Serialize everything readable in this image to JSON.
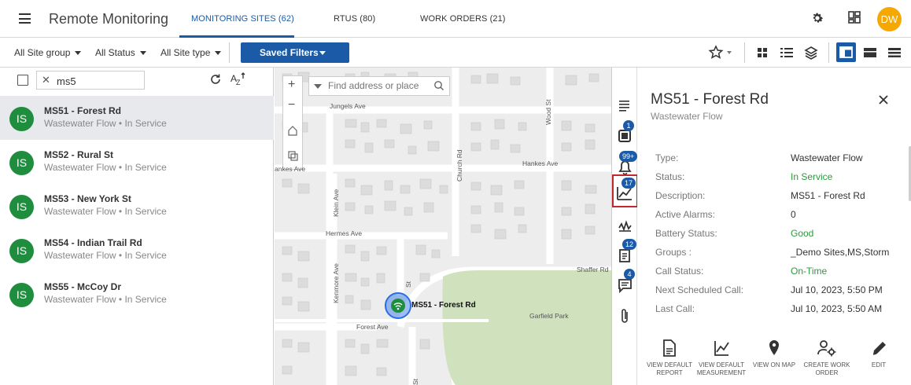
{
  "app": {
    "title": "Remote Monitoring",
    "user_initials": "DW"
  },
  "tabs": [
    {
      "label": "MONITORING SITES (62)",
      "active": true
    },
    {
      "label": "RTUS (80)",
      "active": false
    },
    {
      "label": "WORK ORDERS (21)",
      "active": false
    }
  ],
  "filters": {
    "site_group": "All Site group",
    "status": "All Status",
    "site_type": "All Site type",
    "saved_filters": "Saved Filters"
  },
  "search": {
    "value": "ms5"
  },
  "sites": [
    {
      "initials": "IS",
      "name": "MS51 - Forest Rd",
      "subtitle": "Wastewater Flow • In Service",
      "selected": true
    },
    {
      "initials": "IS",
      "name": "MS52 - Rural St",
      "subtitle": "Wastewater Flow • In Service",
      "selected": false
    },
    {
      "initials": "IS",
      "name": "MS53 - New York St",
      "subtitle": "Wastewater Flow • In Service",
      "selected": false
    },
    {
      "initials": "IS",
      "name": "MS54 - Indian Trail Rd",
      "subtitle": "Wastewater Flow • In Service",
      "selected": false
    },
    {
      "initials": "IS",
      "name": "MS55 - McCoy Dr",
      "subtitle": "Wastewater Flow • In Service",
      "selected": false
    }
  ],
  "map": {
    "search_placeholder": "Find address or place",
    "marker_label": "MS51 - Forest Rd",
    "streets": {
      "jungels": "Jungels Ave",
      "hankes_left": "ankes Ave",
      "hankes_right": "Hankes Ave",
      "hermes": "Hermes Ave",
      "forest": "Forest Ave",
      "shaffer": "Shaffer Rd",
      "klein": "Klein Ave",
      "church": "Church Rd",
      "wood": "Wood St",
      "kenmore": "Kenmore Ave",
      "garfield_park": "Garfield Park",
      "st_label": "St",
      "st_bottom": "St"
    }
  },
  "rail_badges": {
    "rtu": "1",
    "alarms": "99+",
    "measurements": "17",
    "reports": "12",
    "notes": "4"
  },
  "detail": {
    "title": "MS51 - Forest Rd",
    "subtitle": "Wastewater Flow",
    "rows": [
      {
        "key": "Type:",
        "value": "Wastewater Flow",
        "green": false
      },
      {
        "key": "Status:",
        "value": "In Service",
        "green": true
      },
      {
        "key": "Description:",
        "value": "MS51 - Forest Rd",
        "green": false
      },
      {
        "key": "Active Alarms:",
        "value": "0",
        "green": false
      },
      {
        "key": "Battery Status:",
        "value": "Good",
        "green": true
      },
      {
        "key": "Groups :",
        "value": "_Demo Sites,MS,Storm",
        "green": false
      },
      {
        "key": "Call Status:",
        "value": "On-Time",
        "green": true
      },
      {
        "key": "Next Scheduled Call:",
        "value": "Jul 10, 2023, 5:50 PM",
        "green": false
      },
      {
        "key": "Last Call:",
        "value": "Jul 10, 2023, 5:50 AM",
        "green": false
      }
    ],
    "actions": {
      "view_default_report_1": "VIEW DEFAULT",
      "view_default_report_2": "REPORT",
      "view_default_measurement_1": "VIEW DEFAULT",
      "view_default_measurement_2": "MEASUREMENT",
      "view_on_map": "VIEW ON MAP",
      "create_work_order_1": "CREATE WORK",
      "create_work_order_2": "ORDER",
      "edit": "EDIT"
    }
  },
  "colors": {
    "brand_blue": "#1b5aa6",
    "status_green": "#2c9a3c",
    "avatar_green": "#1e8e3e",
    "user_avatar": "#f6a800",
    "highlight_red": "#c0282d"
  }
}
